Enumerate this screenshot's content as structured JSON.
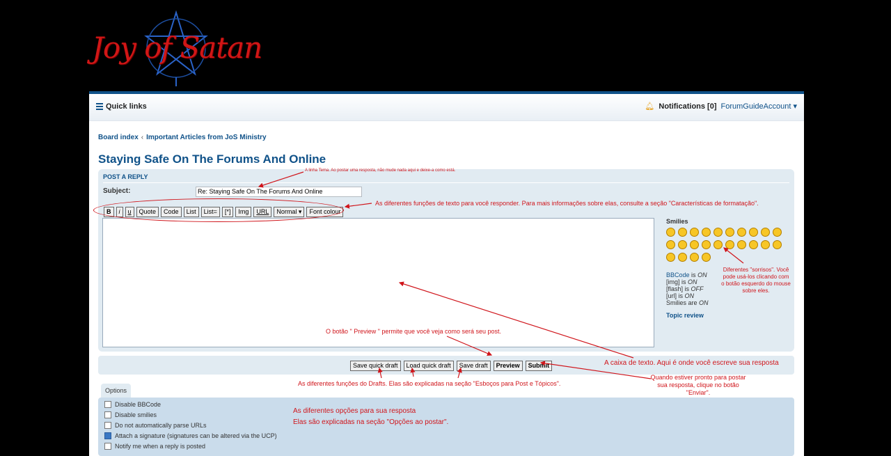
{
  "header": {
    "logo_text": "Joy of Satan"
  },
  "navbar": {
    "quick_links": "Quick links",
    "notifications": "Notifications [0]",
    "account": "ForumGuideAccount"
  },
  "breadcrumb": [
    "Board index",
    "Important Articles from JoS Ministry"
  ],
  "page_title": "Staying Safe On The Forums And Online",
  "reply": {
    "heading": "POST A REPLY",
    "subject_label": "Subject:",
    "subject_value": "Re: Staying Safe On The Forums And Online"
  },
  "toolbar": {
    "buttons": [
      "B",
      "i",
      "u",
      "Quote",
      "Code",
      "List",
      "List=",
      "[*]",
      "Img",
      "URL"
    ],
    "size_select": "Normal",
    "font_colour": "Font colour"
  },
  "smilies": {
    "title": "Smilies",
    "count": 24
  },
  "status": {
    "bbcode": "BBCode",
    "bbcode_state": "ON",
    "img": "[img]",
    "img_state": "ON",
    "flash": "[flash]",
    "flash_state": "OFF",
    "url": "[url]",
    "url_state": "ON",
    "smilies": "Smilies are",
    "smilies_state": "ON",
    "is": "is"
  },
  "topic_review": "Topic review",
  "submit_buttons": {
    "save_quick": "Save quick draft",
    "load_quick": "Load quick draft",
    "save_draft": "Save draft",
    "preview": "Preview",
    "submit": "Submit"
  },
  "options": {
    "tab": "Options",
    "items": [
      {
        "label": "Disable BBCode",
        "checked": false
      },
      {
        "label": "Disable smilies",
        "checked": false
      },
      {
        "label": "Do not automatically parse URLs",
        "checked": false
      },
      {
        "label": "Attach a signature (signatures can be altered via the UCP)",
        "checked": true
      },
      {
        "label": "Notify me when a reply is posted",
        "checked": false
      }
    ]
  },
  "annotations": {
    "subject": "A linha Tema. Ao postar uma resposta, não mude nada aqui e deixe-a como está.",
    "toolbar": "As diferentes funções de texto para você responder. Para mais informações sobre elas, consulte a seção \"Características de formatação\".",
    "smilies": "Diferentes \"sorrisos\". Você pode usá-los clicando com o botão esquerdo do mouse sobre eles.",
    "preview": "O botão \" Preview \" permite que você veja como será seu post.",
    "textbox": "A caixa de texto. Aqui é onde você escreve sua resposta",
    "drafts": "As diferentes funções do Drafts. Elas são explicadas na seção \"Esboços para Post e Tópicos\".",
    "submit": "Quando estiver pronto para postar sua resposta, clique no botão \"Enviar\".",
    "options_line1": "As diferentes opções para sua resposta",
    "options_line2": "Elas são explicadas na seção \"Opções ao postar\"."
  },
  "colors": {
    "accent": "#105289",
    "annotation": "#d0151b",
    "panel": "#e1ebf2"
  }
}
